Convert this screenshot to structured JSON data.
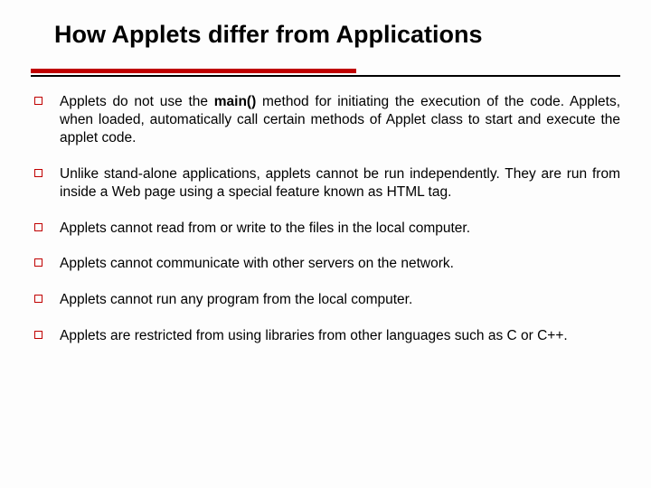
{
  "title": "How Applets differ from Applications",
  "bullets": [
    {
      "pre": "Applets do not use the ",
      "bold": "main()",
      "post": " method for initiating the execution of the code. Applets, when loaded, automatically call certain methods of Applet class to start and execute the applet code."
    },
    {
      "text": "Unlike stand-alone applications, applets cannot be run independently. They are run from inside a Web page using a special feature known as HTML tag."
    },
    {
      "text": "Applets cannot read from or write to the files in the local computer."
    },
    {
      "text": "Applets cannot communicate with other servers on the network."
    },
    {
      "text": "Applets cannot run any program from the local computer."
    },
    {
      "text": "Applets are restricted from using libraries from other languages such as C or C++."
    }
  ]
}
